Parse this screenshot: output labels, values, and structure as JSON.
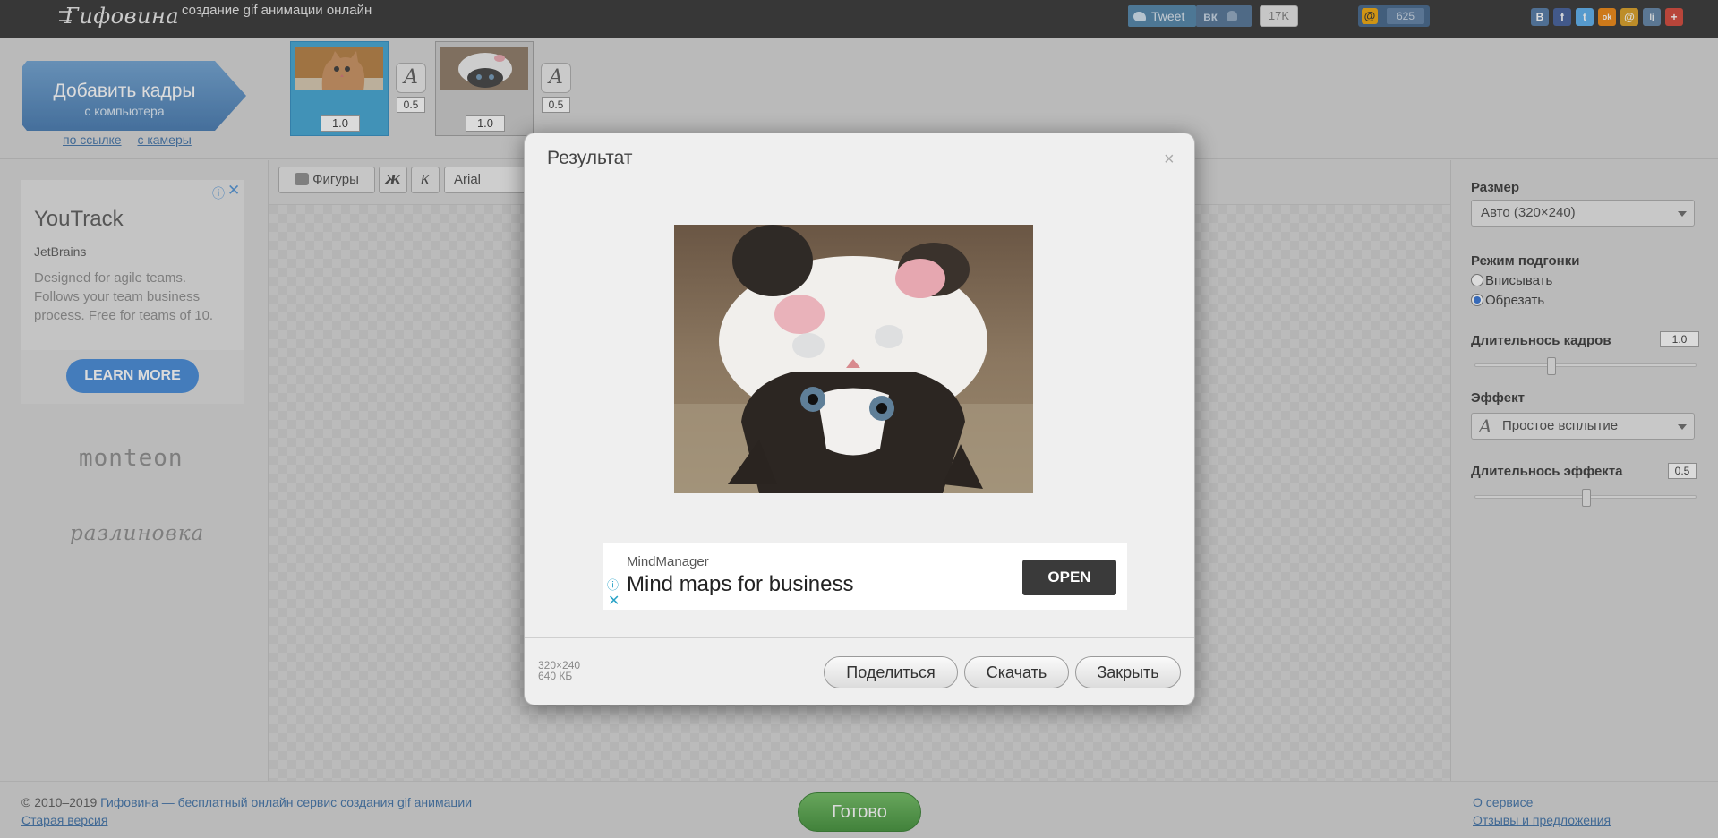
{
  "topbar": {
    "logo": "Гифовина",
    "tagline": "создание gif анимации онлайн",
    "tweet_label": "Tweet",
    "vk_label": "вк",
    "vk_count": "17K",
    "mail_count": "625",
    "share_networks": [
      "В",
      "f",
      "t",
      "ok",
      "@",
      "lj",
      "+"
    ]
  },
  "header": {
    "add_button_title": "Добавить кадры",
    "add_button_sub": "с компьютера",
    "link_url": "по ссылке",
    "link_camera": "с камеры",
    "frames": [
      {
        "duration": "1.0",
        "effect_duration": "0.5"
      },
      {
        "duration": "1.0",
        "effect_duration": "0.5"
      }
    ]
  },
  "left_ad": {
    "title": "YouTrack",
    "sponsor": "JetBrains",
    "description": "Designed for agile teams. Follows your team business process. Free for teams of 10.",
    "cta": "LEARN MORE"
  },
  "left_links": {
    "monteon": "monteon",
    "razlinovka": "разлиновка"
  },
  "toolbar": {
    "shapes_label": "Фигуры",
    "bold_label": "Ж",
    "italic_label": "К",
    "font_value": "Arial"
  },
  "settings": {
    "size_label": "Размер",
    "size_value": "Авто (320×240)",
    "fit_mode_label": "Режим подгонки",
    "fit_option_fit": "Вписывать",
    "fit_option_crop": "Обрезать",
    "fit_selected": "Обрезать",
    "frame_duration_label": "Длительнось кадров",
    "frame_duration_value": "1.0",
    "effect_label": "Эффект",
    "effect_value": "Простое всплытие",
    "effect_duration_label": "Длительнось эффекта",
    "effect_duration_value": "0.5"
  },
  "modal": {
    "title": "Результат",
    "close": "×",
    "dimensions": "320×240",
    "file_size": "640 КБ",
    "share_label": "Поделиться",
    "download_label": "Скачать",
    "close_label": "Закрыть",
    "ad": {
      "brand": "MindManager",
      "headline": "Mind maps for business",
      "cta": "OPEN"
    }
  },
  "footer": {
    "copyright": "© 2010–2019",
    "site_link": "Гифовина — бесплатный онлайн сервис создания gif анимации",
    "old_version": "Старая версия",
    "done_label": "Готово",
    "about": "О сервисе",
    "feedback": "Отзывы и предложения"
  },
  "colors": {
    "accent_blue": "#3a6ea5",
    "done_green": "#4a9f3f",
    "selected_frame": "#3aa2d1"
  }
}
